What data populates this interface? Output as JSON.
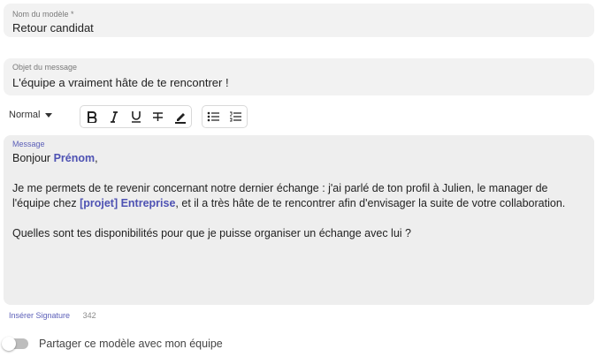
{
  "template_name": {
    "label": "Nom du modèle *",
    "value": "Retour candidat"
  },
  "subject": {
    "label": "Objet du message",
    "value": "L'équipe a vraiment hâte de te rencontrer !"
  },
  "toolbar": {
    "style_select": "Normal",
    "buttons": [
      "bold-icon",
      "italic-icon",
      "underline-icon",
      "strikethrough-icon",
      "text-color-icon",
      "bullet-list-icon",
      "numbered-list-icon"
    ]
  },
  "message": {
    "label": "Message",
    "greeting": "Bonjour ",
    "firstname_tag": "Prénom",
    "greeting_end": ",",
    "p2_part1": "Je me permets de te revenir concernant notre dernier échange : j'ai parlé de ton profil à Julien, le manager de l'équipe chez ",
    "company_tag": "[projet] Entreprise",
    "p2_part2": ", et il a très hâte de te rencontrer afin d'envisager la suite de votre collaboration.",
    "p3": "Quelles sont tes disponibilités pour que je puisse organiser un échange avec lui ?"
  },
  "footer": {
    "signature_link": "Insérer Signature",
    "char_count": "342"
  },
  "share": {
    "label": "Partager ce modèle avec mon équipe",
    "enabled": false
  },
  "colors": {
    "accent": "#5b5fb8",
    "field_bg": "#f2f2f2"
  }
}
